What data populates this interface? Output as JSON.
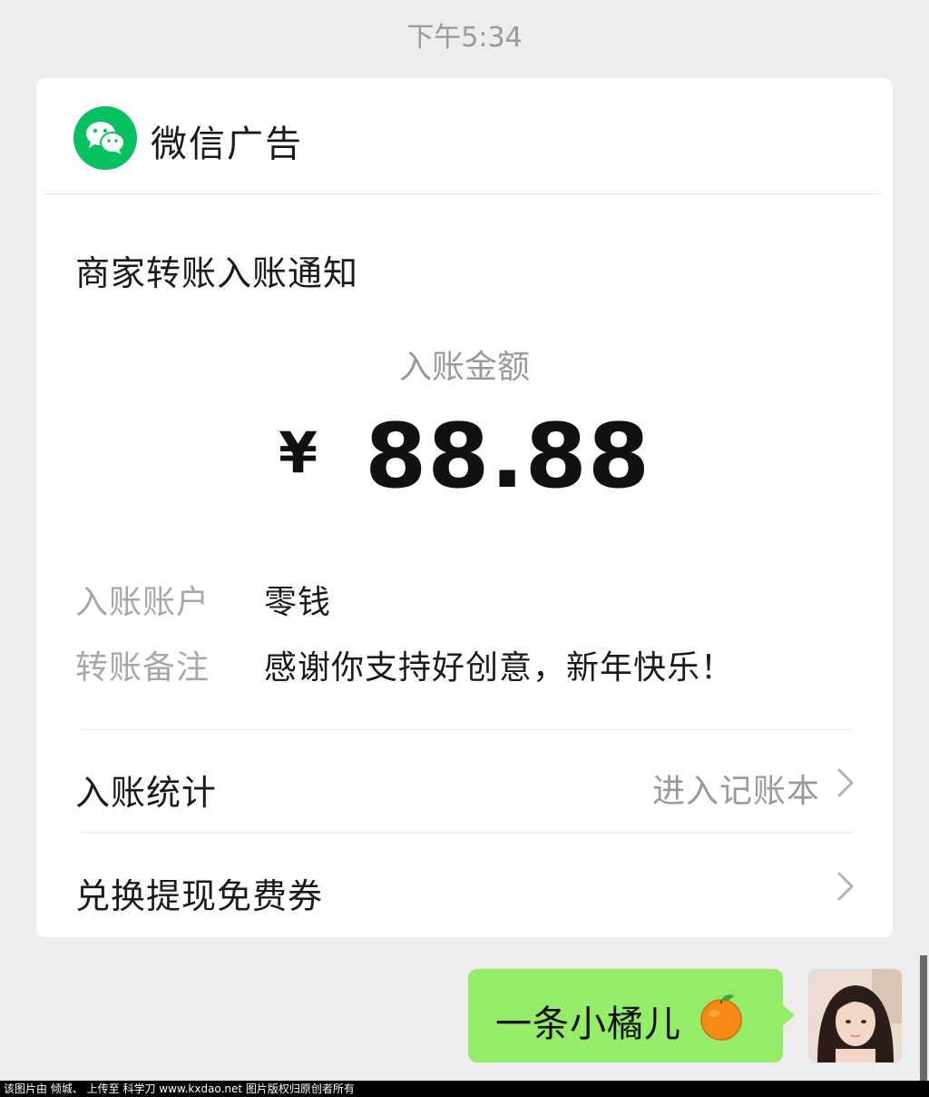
{
  "timestamp": "下午5:34",
  "card": {
    "sender_name": "微信广告",
    "title": "商家转账入账通知",
    "amount_label": "入账金额",
    "currency_symbol": "¥",
    "amount": "88.88",
    "details": [
      {
        "label": "入账账户",
        "value": "零钱"
      },
      {
        "label": "转账备注",
        "value": "感谢你支持好创意，新年快乐！"
      }
    ],
    "rows": [
      {
        "title": "入账统计",
        "link": "进入记账本"
      },
      {
        "title": "兑换提现免费券",
        "link": ""
      }
    ]
  },
  "message": {
    "text": "一条小橘儿",
    "emoji_icon": "tangerine-icon"
  },
  "watermark": "该图片由 倾城、 上传至 科学刀 www.kxdao.net 图片版权归原创者所有",
  "colors": {
    "background": "#ededed",
    "card": "#ffffff",
    "wechat_green": "#07c160",
    "bubble": "#95ec69",
    "secondary_text": "#9a9a9a"
  }
}
